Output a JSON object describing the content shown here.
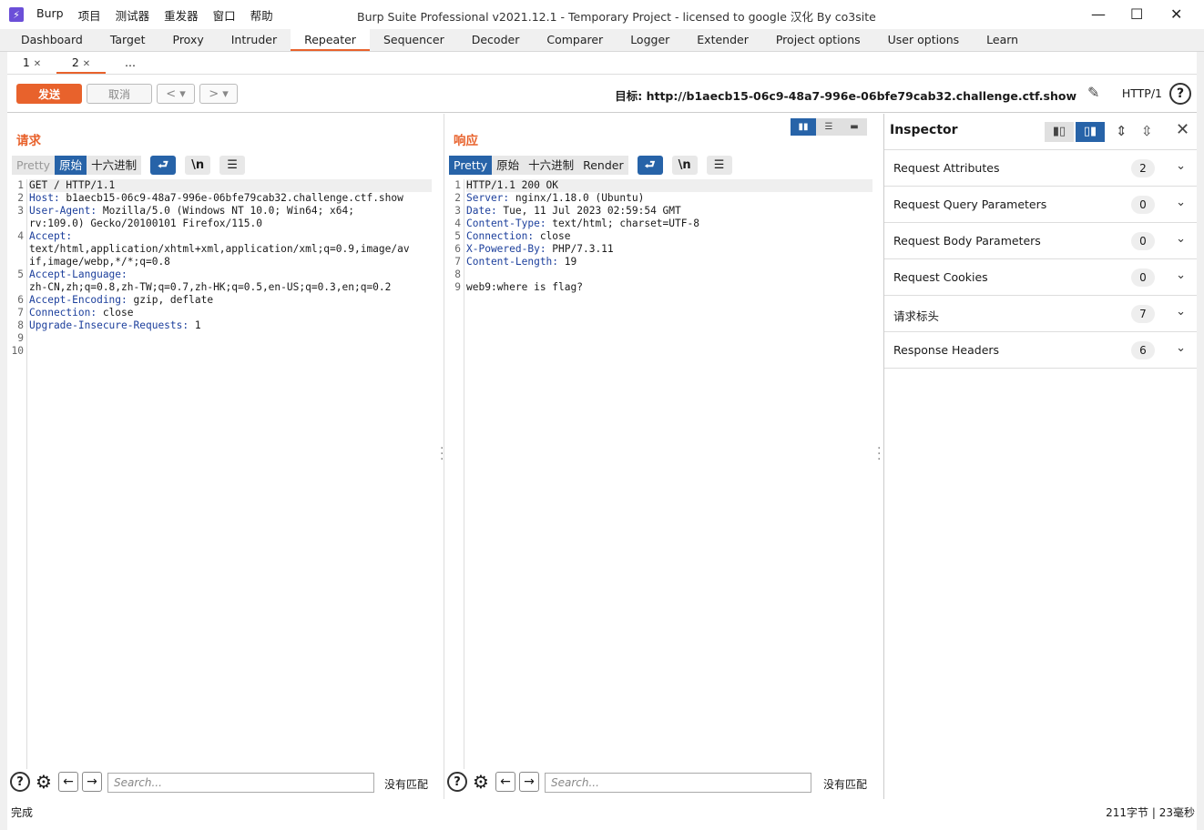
{
  "window": {
    "app_menu": [
      "Burp",
      "项目",
      "测试器",
      "重发器",
      "窗口",
      "帮助"
    ],
    "title": "Burp Suite Professional v2021.12.1 - Temporary Project - licensed to google 汉化 By co3site"
  },
  "main_tabs": [
    "Dashboard",
    "Target",
    "Proxy",
    "Intruder",
    "Repeater",
    "Sequencer",
    "Decoder",
    "Comparer",
    "Logger",
    "Extender",
    "Project options",
    "User options",
    "Learn"
  ],
  "active_main_tab": "Repeater",
  "sub_tabs": [
    {
      "label": "1"
    },
    {
      "label": "2"
    },
    {
      "label": "..."
    }
  ],
  "toolbar": {
    "send": "发送",
    "cancel": "取消",
    "target_label": "目标: http://b1aecb15-06c9-48a7-996e-06bfe79cab32.challenge.ctf.show",
    "http_version": "HTTP/1"
  },
  "request": {
    "title": "请求",
    "views": [
      "Pretty",
      "原始",
      "十六进制"
    ],
    "lines": [
      {
        "n": "1",
        "k": "",
        "v": "GET / HTTP/1.1"
      },
      {
        "n": "2",
        "k": "Host:",
        "v": " b1aecb15-06c9-48a7-996e-06bfe79cab32.challenge.ctf.show"
      },
      {
        "n": "3",
        "k": "User-Agent:",
        "v": " Mozilla/5.0 (Windows NT 10.0; Win64; x64;"
      },
      {
        "n": "",
        "k": "",
        "v": "rv:109.0) Gecko/20100101 Firefox/115.0"
      },
      {
        "n": "4",
        "k": "Accept:",
        "v": ""
      },
      {
        "n": "",
        "k": "",
        "v": "text/html,application/xhtml+xml,application/xml;q=0.9,image/av"
      },
      {
        "n": "",
        "k": "",
        "v": "if,image/webp,*/*;q=0.8"
      },
      {
        "n": "5",
        "k": "Accept-Language:",
        "v": ""
      },
      {
        "n": "",
        "k": "",
        "v": "zh-CN,zh;q=0.8,zh-TW;q=0.7,zh-HK;q=0.5,en-US;q=0.3,en;q=0.2"
      },
      {
        "n": "6",
        "k": "Accept-Encoding:",
        "v": " gzip, deflate"
      },
      {
        "n": "7",
        "k": "Connection:",
        "v": " close"
      },
      {
        "n": "8",
        "k": "Upgrade-Insecure-Requests:",
        "v": " 1"
      },
      {
        "n": "9",
        "k": "",
        "v": ""
      },
      {
        "n": "10",
        "k": "",
        "v": ""
      }
    ],
    "search_placeholder": "Search...",
    "no_match": "没有匹配"
  },
  "response": {
    "title": "响应",
    "views": [
      "Pretty",
      "原始",
      "十六进制",
      "Render"
    ],
    "lines": [
      {
        "n": "1",
        "k": "",
        "v": "HTTP/1.1 200 OK"
      },
      {
        "n": "2",
        "k": "Server:",
        "v": " nginx/1.18.0 (Ubuntu)"
      },
      {
        "n": "3",
        "k": "Date:",
        "v": " Tue, 11 Jul 2023 02:59:54 GMT"
      },
      {
        "n": "4",
        "k": "Content-Type:",
        "v": " text/html; charset=UTF-8"
      },
      {
        "n": "5",
        "k": "Connection:",
        "v": " close"
      },
      {
        "n": "6",
        "k": "X-Powered-By:",
        "v": " PHP/7.3.11"
      },
      {
        "n": "7",
        "k": "Content-Length:",
        "v": " 19"
      },
      {
        "n": "8",
        "k": "",
        "v": ""
      },
      {
        "n": "9",
        "k": "",
        "v": "web9:where is flag?"
      }
    ],
    "search_placeholder": "Search...",
    "no_match": "没有匹配"
  },
  "inspector": {
    "title": "Inspector",
    "sections": [
      {
        "label": "Request Attributes",
        "count": "2"
      },
      {
        "label": "Request Query Parameters",
        "count": "0"
      },
      {
        "label": "Request Body Parameters",
        "count": "0"
      },
      {
        "label": "Request Cookies",
        "count": "0"
      },
      {
        "label": "请求标头",
        "count": "7"
      },
      {
        "label": "Response Headers",
        "count": "6"
      }
    ]
  },
  "status": {
    "left": "完成",
    "right": "211字节 | 23毫秒"
  },
  "colors": {
    "accent": "#e8622c",
    "active_blue": "#2763a8",
    "header_key": "#1c3f9c"
  }
}
